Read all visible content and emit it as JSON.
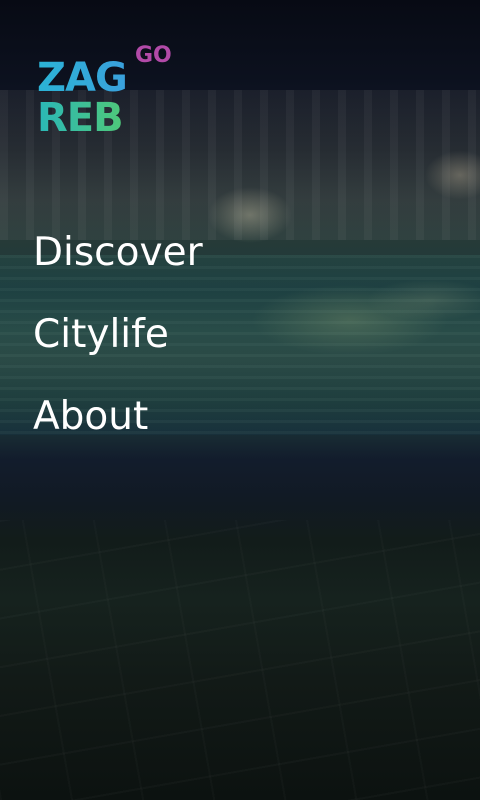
{
  "logo": {
    "line1": "ZAG",
    "line2": "REB",
    "superscript": "GO"
  },
  "menu": {
    "items": [
      {
        "label": "Discover"
      },
      {
        "label": "Citylife"
      },
      {
        "label": "About"
      }
    ]
  },
  "colors": {
    "logo_blue": "#2bb3d6",
    "logo_green": "#4fc879",
    "logo_go": "#b24aa8",
    "menu_text": "#ffffff"
  }
}
